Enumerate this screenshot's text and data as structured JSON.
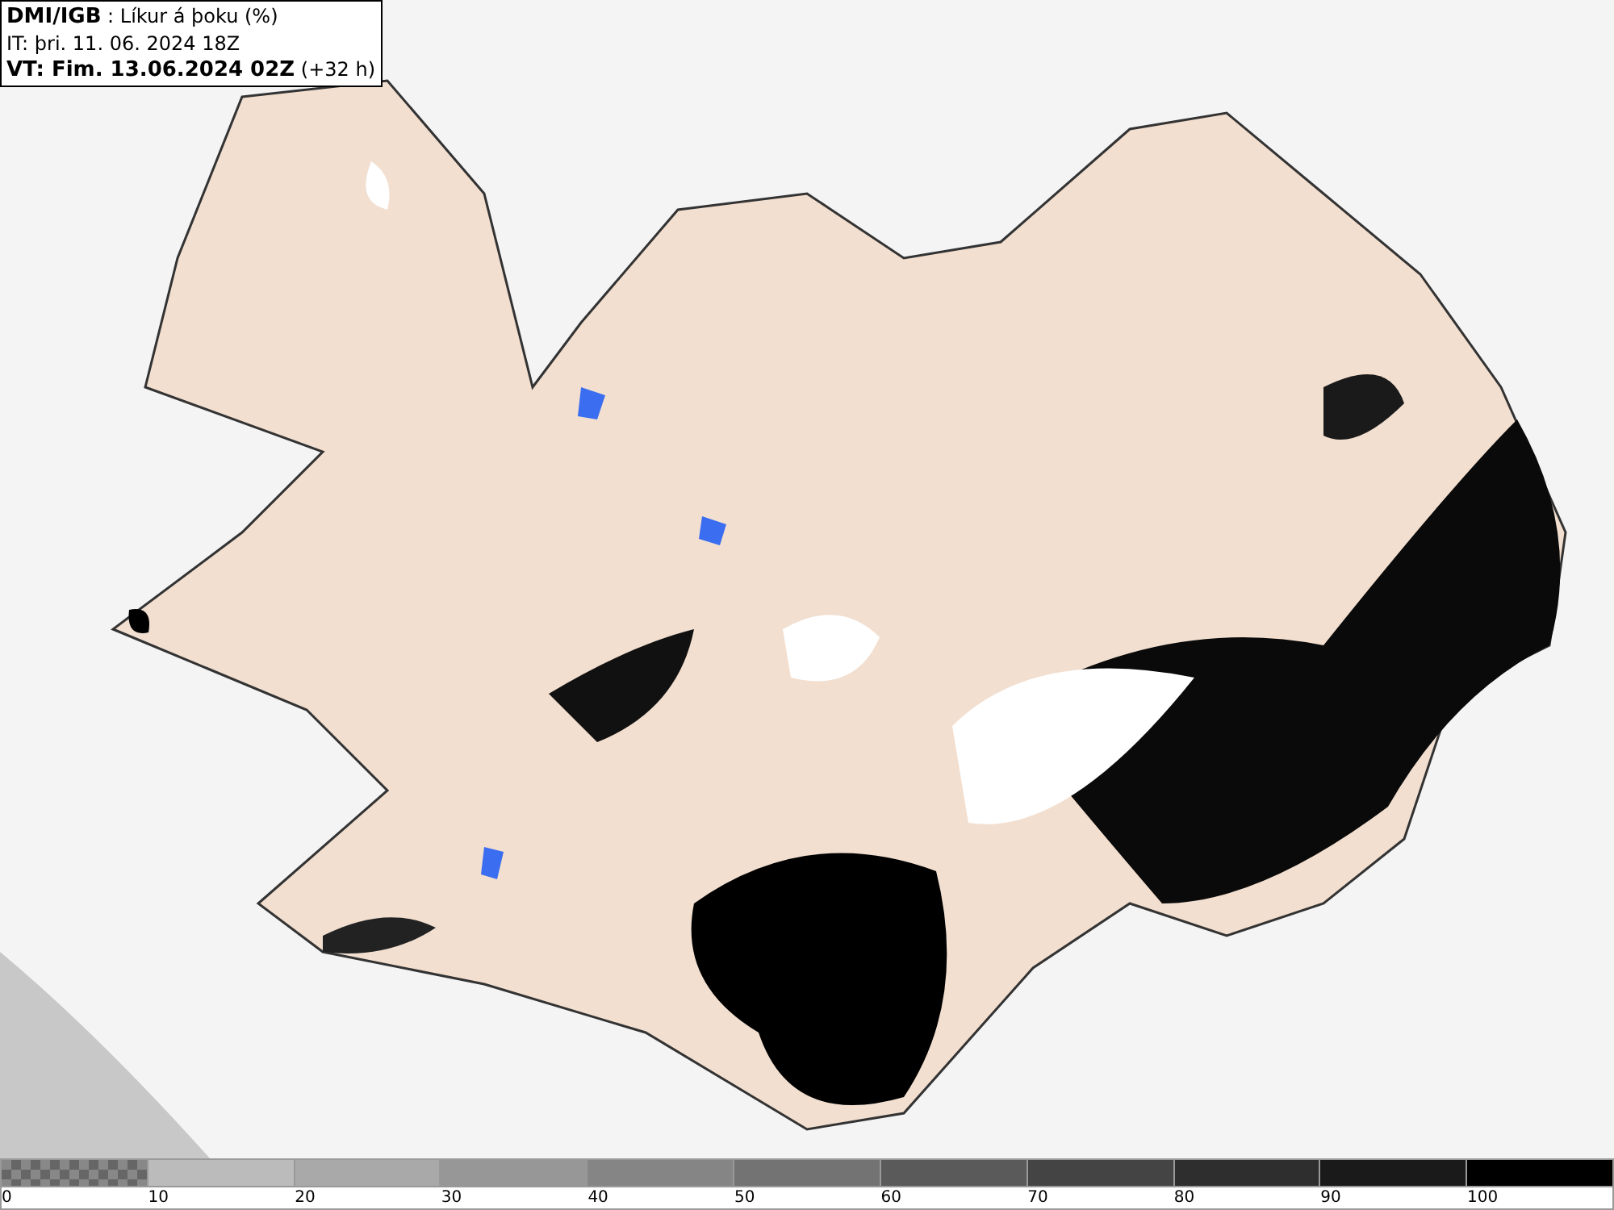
{
  "header": {
    "source": "DMI/IGB",
    "product": " : Líkur á þoku (%)",
    "issue_time": "IT: þri. 11. 06. 2024 18Z",
    "valid_time": "VT: Fim. 13.06.2024 02Z",
    "lead": "(+32 h)"
  },
  "legend": {
    "bins": [
      {
        "color": "#888888",
        "kind": "checker"
      },
      {
        "color": "#bbbbbb",
        "kind": "solid"
      },
      {
        "color": "#a9a9a9",
        "kind": "solid"
      },
      {
        "color": "#979797",
        "kind": "solid"
      },
      {
        "color": "#858585",
        "kind": "solid"
      },
      {
        "color": "#737373",
        "kind": "solid"
      },
      {
        "color": "#5a5a5a",
        "kind": "solid"
      },
      {
        "color": "#444444",
        "kind": "solid"
      },
      {
        "color": "#2e2e2e",
        "kind": "solid"
      },
      {
        "color": "#1a1a1a",
        "kind": "solid"
      },
      {
        "color": "#000000",
        "kind": "solid"
      }
    ],
    "labels": [
      "0",
      "10",
      "20",
      "30",
      "40",
      "50",
      "60",
      "70",
      "80",
      "90",
      "100"
    ]
  }
}
